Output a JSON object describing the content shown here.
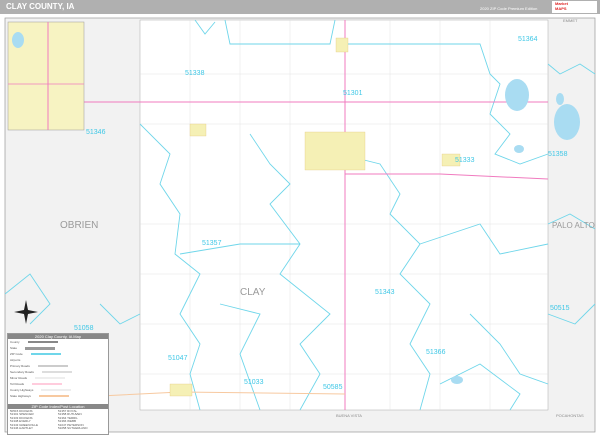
{
  "header": {
    "title": "CLAY COUNTY, IA",
    "edition": "2020 ZIP Code Premium Edition",
    "logo_text": [
      "Market",
      "MAPS"
    ]
  },
  "map": {
    "county_label": "CLAY",
    "neighbors": {
      "west": "OBRIEN",
      "east": "PALO ALTO",
      "south": "BUENA VISTA",
      "southeast": "POCAHONTAS",
      "northeast": "EMMET"
    },
    "zip_labels": [
      "51338",
      "51301",
      "51364",
      "51346",
      "51333",
      "51358",
      "51357",
      "51343",
      "51058",
      "51047",
      "51033",
      "51366",
      "50585",
      "50515"
    ],
    "colors": {
      "zip_boundary": "#6fd6ea",
      "highway": "#f07bbf",
      "state_route": "#f7c9a0",
      "city": "#f5f0b5",
      "water": "#a9dcf2",
      "frame": "#b0b0b0"
    }
  },
  "legend": {
    "title": "2020 Clay County, IA Map",
    "items": [
      "County",
      "State",
      "ZIP Code",
      "Airports",
      "Primary Roads",
      "Secondary Roads",
      "Minor Roads",
      "Toll Roads",
      "County Highways",
      "State Highways",
      "US Highways",
      "Interstate Highways",
      "Rail Roads"
    ],
    "index_title": "ZIP Code Index/Post Location",
    "zip_index": [
      "50515 DICKENS",
      "51301 SPENCER",
      "51333 DICKENS",
      "51338 EVERLY",
      "51343 GREENVILLE",
      "51346 HARTLEY",
      "51357 ROYAL",
      "51358 RUTHVEN",
      "51364 TERRIL",
      "51366 WEBB",
      "51047 PETERSON",
      "51058 SUTHERLAND"
    ]
  }
}
